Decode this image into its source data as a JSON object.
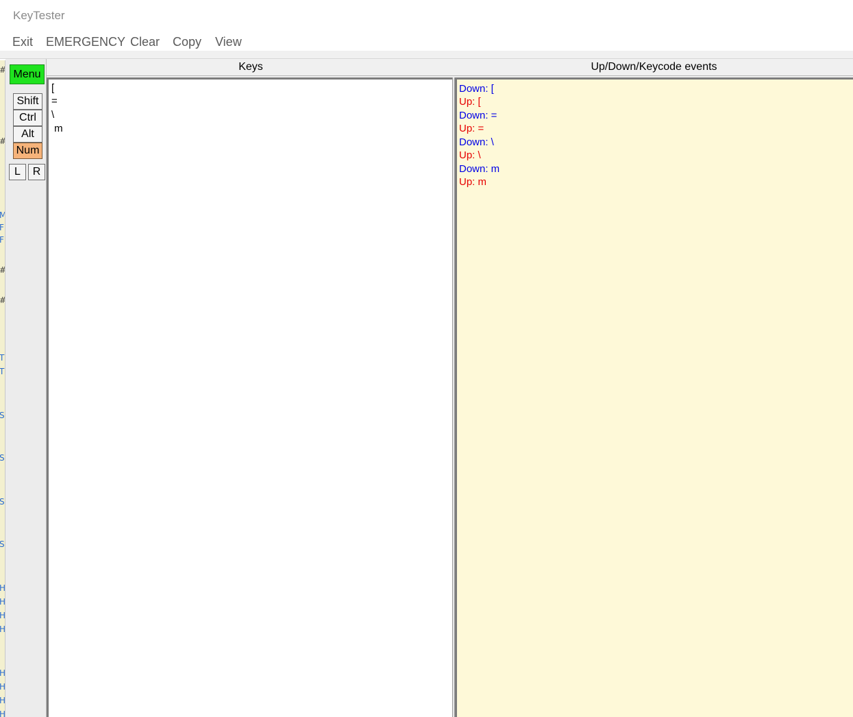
{
  "window": {
    "title": "KeyTester"
  },
  "menu": {
    "items": [
      {
        "label": "Exit"
      },
      {
        "label": "EMERGENCY"
      },
      {
        "label": "Clear"
      },
      {
        "label": "Copy"
      },
      {
        "label": "View"
      }
    ]
  },
  "modifiers": {
    "menu_label": "Menu",
    "shift_label": "Shift",
    "ctrl_label": "Ctrl",
    "alt_label": "Alt",
    "num_label": "Num",
    "left_label": "L",
    "right_label": "R"
  },
  "keys_panel": {
    "header": "Keys",
    "lines": [
      "[",
      "=",
      "\\",
      " m"
    ]
  },
  "events_panel": {
    "header": "Up/Down/Keycode events",
    "events": [
      {
        "type": "down",
        "text": "Down: ["
      },
      {
        "type": "up",
        "text": "Up: ["
      },
      {
        "type": "down",
        "text": "Down: ="
      },
      {
        "type": "up",
        "text": "Up: ="
      },
      {
        "type": "down",
        "text": "Down: \\"
      },
      {
        "type": "up",
        "text": "Up: \\"
      },
      {
        "type": "down",
        "text": "Down: m"
      },
      {
        "type": "up",
        "text": "Up: m"
      }
    ]
  },
  "colors": {
    "menu_active": "#1fe31f",
    "num_active": "#f6b37a",
    "down_event": "#0000e6",
    "up_event": "#e60000",
    "events_bg": "#fef9d8"
  }
}
